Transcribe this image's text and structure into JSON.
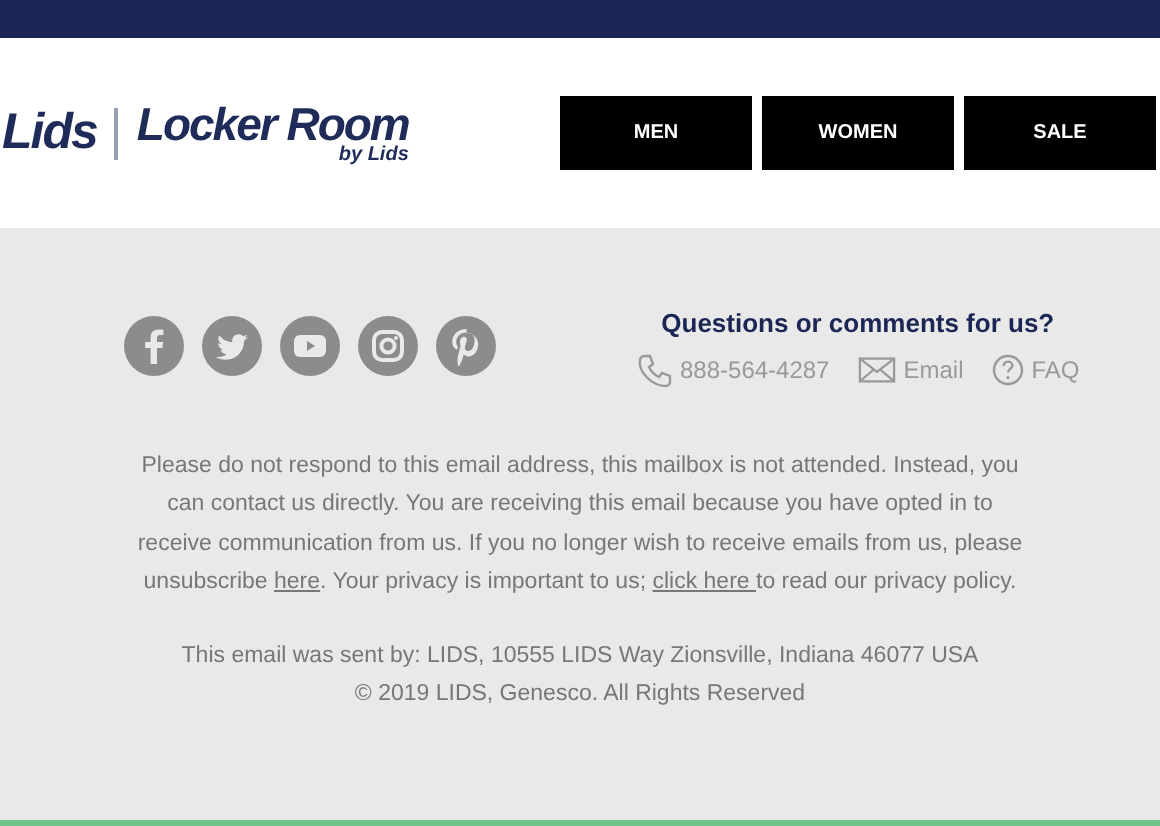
{
  "logo": {
    "brand": "Lids",
    "name": "Locker Room",
    "byline": "by Lids"
  },
  "nav": [
    {
      "label": "MEN"
    },
    {
      "label": "WOMEN"
    },
    {
      "label": "SALE"
    }
  ],
  "social": [
    {
      "kind": "facebook"
    },
    {
      "kind": "twitter"
    },
    {
      "kind": "youtube"
    },
    {
      "kind": "instagram"
    },
    {
      "kind": "pinterest"
    }
  ],
  "contact": {
    "heading": "Questions or comments for us?",
    "items": [
      {
        "kind": "phone",
        "label": "888-564-4287"
      },
      {
        "kind": "email",
        "label": "Email"
      },
      {
        "kind": "faq",
        "label": "FAQ"
      }
    ]
  },
  "notice": [
    {
      "kind": "text",
      "text": "Please do not respond to this email address, this mailbox is not attended. Instead, you can contact us directly. You are receiving this email because you have opted in to receive communication from us. If you no longer wish to receive emails from us, please unsubscribe "
    },
    {
      "kind": "link",
      "text": "here"
    },
    {
      "kind": "text",
      "text": ". Your privacy is important to us; "
    },
    {
      "kind": "link",
      "text": "click here "
    },
    {
      "kind": "text",
      "text": "to read our privacy policy."
    }
  ],
  "footer": [
    "This email was sent by: LIDS, 10555 LIDS Way Zionsville, Indiana 46077 USA",
    "© 2019 LIDS, Genesco. All Rights Reserved"
  ]
}
